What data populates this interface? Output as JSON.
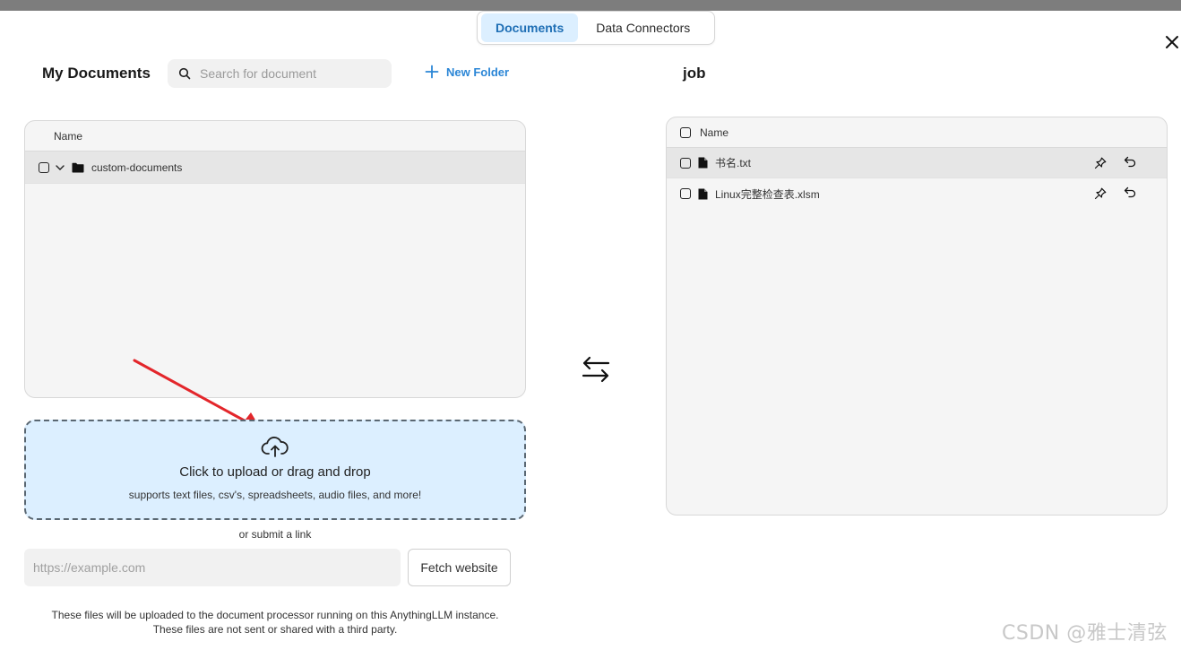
{
  "tabs": [
    {
      "label": "Documents",
      "active": true
    },
    {
      "label": "Data Connectors",
      "active": false
    }
  ],
  "left": {
    "title": "My Documents",
    "search_placeholder": "Search for document",
    "new_folder_label": "New Folder",
    "column_name": "Name",
    "folders": [
      {
        "name": "custom-documents",
        "expanded": true
      }
    ]
  },
  "upload": {
    "title": "Click to upload or drag and drop",
    "subtitle": "supports text files, csv's, spreadsheets, audio files, and more!",
    "or_link": "or submit a link",
    "url_placeholder": "https://example.com",
    "fetch_label": "Fetch website",
    "note_line1": "These files will be uploaded to the document processor running on this AnythingLLM instance.",
    "note_line2": "These files are not sent or shared with a third party."
  },
  "right": {
    "title": "job",
    "column_name": "Name",
    "files": [
      {
        "name": "书名.txt"
      },
      {
        "name": "Linux完整检查表.xlsm"
      }
    ]
  },
  "watermark": "CSDN @雅士清弦",
  "colors": {
    "accent": "#2b86d6",
    "active_tab_bg": "#dcefff",
    "dropzone_bg": "#dcefff",
    "annotation_arrow": "#e3262b"
  },
  "icons": {
    "search": "search-icon",
    "plus": "plus-icon",
    "close": "close-icon",
    "folder": "folder-icon",
    "file": "file-icon",
    "pin": "pin-icon",
    "undo": "undo-icon",
    "swap": "swap-arrows-icon",
    "upload": "cloud-upload-icon"
  }
}
